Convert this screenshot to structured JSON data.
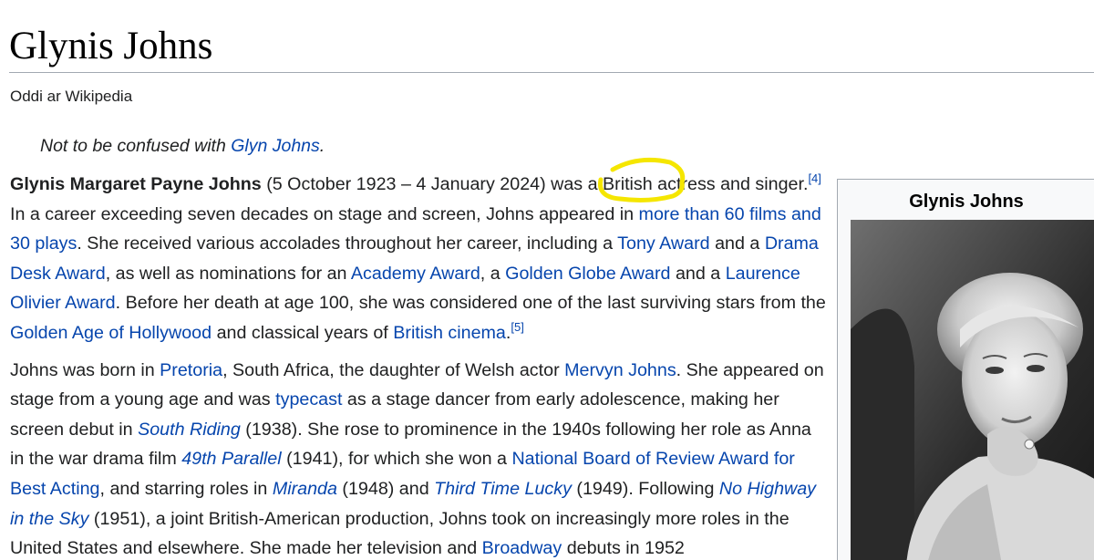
{
  "page": {
    "title": "Glynis Johns",
    "tagline": "Oddi ar Wikipedia"
  },
  "hatnote": {
    "prefix": "Not to be confused with ",
    "link": "Glyn Johns",
    "suffix": "."
  },
  "infobox": {
    "title": "Glynis Johns",
    "photo_icon": "portrait-photo"
  },
  "highlight": {
    "color": "#f5e600",
    "icon": "yellow-circle-annotation"
  },
  "paragraph1": {
    "t0": "Glynis Margaret Payne Johns",
    "t1": " (5 October 1923 – 4 January 2024) was a British actress and singer.",
    "ref4": "[4]",
    "t2": " In a career exceeding seven decades on stage and screen, Johns appeared in ",
    "l_more": "more than 60 films and 30 plays",
    "t3": ". She received various accolades throughout her career, including a ",
    "l_tony": "Tony Award",
    "t4": " and a ",
    "l_dda": "Drama Desk Award",
    "t5": ", as well as nominations for an ",
    "l_academy": "Academy Award",
    "t6": ", a ",
    "l_globe": "Golden Globe Award",
    "t7": " and a ",
    "l_olivier": "Laurence Olivier Award",
    "t8": ". Before her death at age 100, she was considered one of the last surviving stars from the ",
    "l_golden": "Golden Age of Hollywood",
    "t9": " and classical years of ",
    "l_cinema": "British cinema",
    "t10": ".",
    "ref5": "[5]"
  },
  "paragraph2": {
    "t0": "Johns was born in ",
    "l_pretoria": "Pretoria",
    "t1": ", South Africa, the daughter of Welsh actor ",
    "l_mervyn": "Mervyn Johns",
    "t2": ". She appeared on stage from a young age and was ",
    "l_typecast": "typecast",
    "t3": " as a stage dancer from early adolescence, making her screen debut in ",
    "l_south": "South Riding",
    "t4": " (1938). She rose to prominence in the 1940s following her role as Anna in the war drama film ",
    "l_parallel": "49th Parallel",
    "t5": " (1941), for which she won a ",
    "l_nbr": "National Board of Review Award for Best Acting",
    "t6": ", and starring roles in ",
    "l_miranda": "Miranda",
    "t7": " (1948) and ",
    "l_third": "Third Time Lucky",
    "t8": " (1949). Following ",
    "l_highway": "No Highway in the Sky",
    "t9": " (1951), a joint British-American production, Johns took on increasingly more roles in the United States and elsewhere. She made her television and ",
    "l_broadway": "Broadway",
    "t10": " debuts in 1952"
  }
}
